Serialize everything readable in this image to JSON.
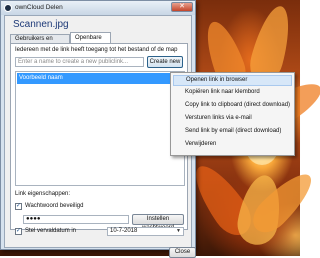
{
  "window": {
    "title": "ownCloud Delen",
    "file_name": "Scannen.jpg",
    "tabs": [
      {
        "label": "Gebruikers en Groepen",
        "active": false
      },
      {
        "label": "Openbare Links",
        "active": true
      }
    ]
  },
  "links_tab": {
    "info_text": "Iedereen met de link heeft toegang tot het bestand of de map",
    "new_link_placeholder": "Enter a name to create a new publiclink...",
    "create_new_label": "Create new",
    "selected_link_name": "Voorbeeld naam",
    "props_label": "Link eigenschappen:",
    "password_checkbox_label": "Wachtwoord beveiligd",
    "password_checked": true,
    "password_value": "●●●●",
    "set_password_label": "Instellen wachtwoord",
    "expiry_checkbox_label": "Stel vervaldatum in",
    "expiry_checked": true,
    "expiry_date": "10-7-2018"
  },
  "context_menu": {
    "items": [
      {
        "label": "Openen link in browser",
        "highlighted": true
      },
      {
        "label": "Kopiëren link naar klembord",
        "highlighted": false
      },
      {
        "label": "Copy link to clipboard (direct download)",
        "highlighted": false
      },
      {
        "label": "Versturen links via e-mail",
        "highlighted": false
      },
      {
        "label": "Send link by email (direct download)",
        "highlighted": false
      },
      {
        "label": "Verwijderen",
        "highlighted": false
      }
    ]
  },
  "footer": {
    "close_label": "Close"
  },
  "title_buttons": {
    "close_glyph": "✕"
  },
  "colors": {
    "selection": "#3399ff",
    "menu_highlight": "#d7e7f8",
    "title_text": "#1e3a78"
  }
}
